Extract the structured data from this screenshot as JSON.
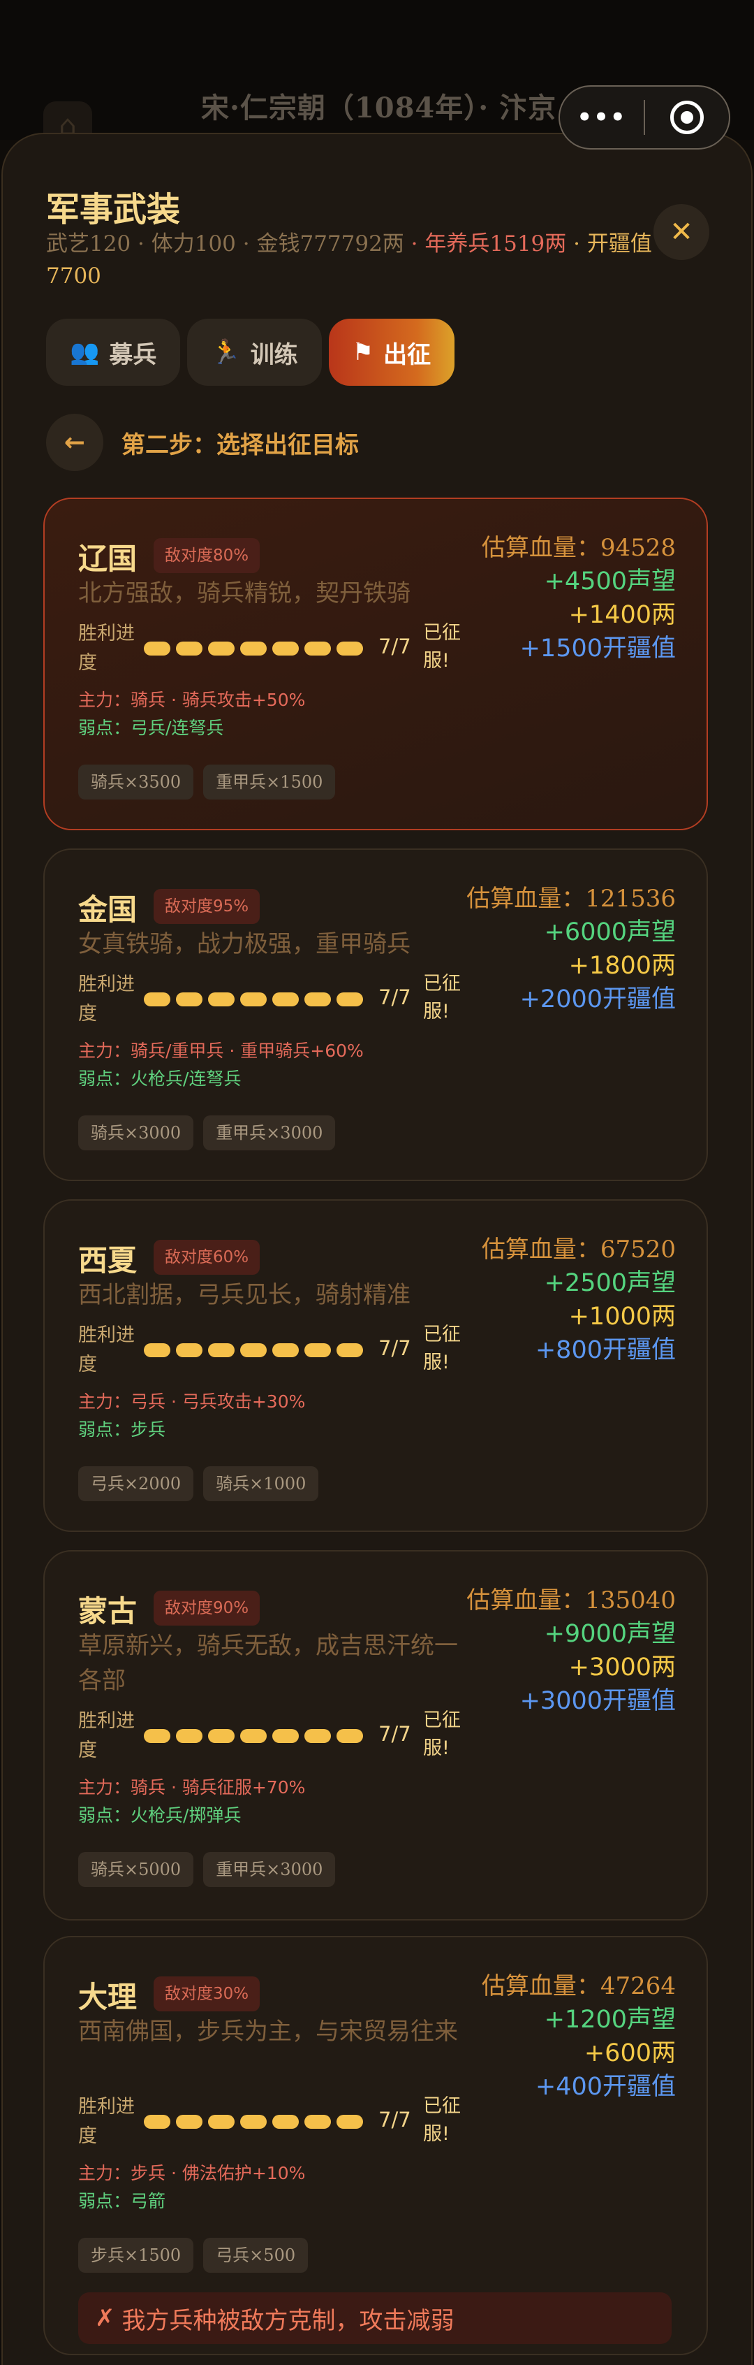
{
  "topbar": {
    "title": "宋·仁宗朝（1084年）· 汴京",
    "more_icon": "•••"
  },
  "sheet": {
    "title": "军事武装",
    "stats": {
      "martial": "武艺120",
      "stamina": "体力100",
      "money": "金钱777792两",
      "upkeep": "年养兵1519两",
      "territory": "开疆值7700",
      "sep": " · "
    },
    "close_icon": "✕"
  },
  "tabs": [
    {
      "label": "募兵",
      "icon": "users-icon",
      "glyph": "👥",
      "active": false
    },
    {
      "label": "训练",
      "icon": "running-icon",
      "glyph": "🏃",
      "active": false
    },
    {
      "label": "出征",
      "icon": "flag-icon",
      "glyph": "⚑",
      "active": true
    }
  ],
  "step": {
    "back_icon": "←",
    "text": "第二步：选择出征目标"
  },
  "labels": {
    "est_prefix": "估算血量：",
    "progress": "胜利进度",
    "conquered": "已征服!",
    "main_prefix": "主力：",
    "weak_prefix": "弱点："
  },
  "targets": [
    {
      "name": "辽国",
      "hostility": "敌对度80%",
      "desc": "北方强敌，骑兵精锐，契丹铁骑",
      "hp": "94528",
      "reputation": "+4500声望",
      "gold": "+1400两",
      "territory": "+1500开疆值",
      "progress": "7/7",
      "progress_filled": 7,
      "progress_total": 7,
      "main": "骑兵 · 骑兵攻击+50%",
      "weak": "弓兵/连弩兵",
      "troops": [
        "骑兵×3500",
        "重甲兵×1500"
      ],
      "selected": true
    },
    {
      "name": "金国",
      "hostility": "敌对度95%",
      "desc": "女真铁骑，战力极强，重甲骑兵",
      "hp": "121536",
      "reputation": "+6000声望",
      "gold": "+1800两",
      "territory": "+2000开疆值",
      "progress": "7/7",
      "progress_filled": 7,
      "progress_total": 7,
      "main": "骑兵/重甲兵 · 重甲骑兵+60%",
      "weak": "火枪兵/连弩兵",
      "troops": [
        "骑兵×3000",
        "重甲兵×3000"
      ],
      "selected": false
    },
    {
      "name": "西夏",
      "hostility": "敌对度60%",
      "desc": "西北割据，弓兵见长，骑射精准",
      "hp": "67520",
      "reputation": "+2500声望",
      "gold": "+1000两",
      "territory": "+800开疆值",
      "progress": "7/7",
      "progress_filled": 7,
      "progress_total": 7,
      "main": "弓兵 · 弓兵攻击+30%",
      "weak": "步兵",
      "troops": [
        "弓兵×2000",
        "骑兵×1000"
      ],
      "selected": false
    },
    {
      "name": "蒙古",
      "hostility": "敌对度90%",
      "desc": "草原新兴，骑兵无敌，成吉思汗统一各部",
      "hp": "135040",
      "reputation": "+9000声望",
      "gold": "+3000两",
      "territory": "+3000开疆值",
      "progress": "7/7",
      "progress_filled": 7,
      "progress_total": 7,
      "main": "骑兵 · 骑兵征服+70%",
      "weak": "火枪兵/掷弹兵",
      "troops": [
        "骑兵×5000",
        "重甲兵×3000"
      ],
      "selected": false
    },
    {
      "name": "大理",
      "hostility": "敌对度30%",
      "desc": "西南佛国，步兵为主，与宋贸易往来",
      "hp": "47264",
      "reputation": "+1200声望",
      "gold": "+600两",
      "territory": "+400开疆值",
      "progress": "7/7",
      "progress_filled": 7,
      "progress_total": 7,
      "main": "步兵 · 佛法佑护+10%",
      "weak": "弓箭",
      "troops": [
        "步兵×1500",
        "弓兵×500"
      ],
      "selected": false
    }
  ],
  "warning": {
    "icon": "✗",
    "text": "我方兵种被敌方克制，攻击减弱"
  },
  "colors": {
    "accent": "#e2a347",
    "danger": "#e46a5a",
    "reputation": "#55d47f",
    "gold": "#f5c947",
    "territory": "#5c97f0"
  }
}
